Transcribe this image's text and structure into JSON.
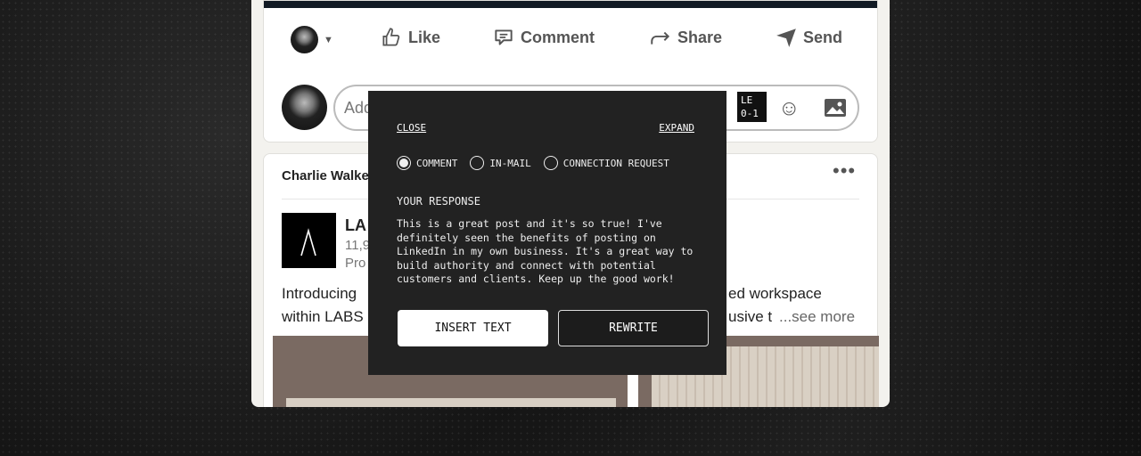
{
  "post_actions": {
    "like": "Like",
    "comment": "Comment",
    "share": "Share",
    "send": "Send"
  },
  "comment_input": {
    "placeholder_visible": "Add"
  },
  "extension_badge": {
    "line1": "LE",
    "line2": "0-1"
  },
  "feed_post": {
    "author_visible": "Charlie Walke",
    "company_visible": "LA",
    "followers_visible": "11,9",
    "promoted_visible": "Pro",
    "text_left_1": "Introducing",
    "text_left_2": "within LABS",
    "text_right_1": "ed workspace",
    "text_right_2": "usive t",
    "see_more": "...see more"
  },
  "popup": {
    "close": "CLOSE",
    "expand": "EXPAND",
    "options": [
      {
        "label": "COMMENT",
        "selected": true
      },
      {
        "label": "IN-MAIL",
        "selected": false
      },
      {
        "label": "CONNECTION REQUEST",
        "selected": false
      }
    ],
    "response_label": "YOUR RESPONSE",
    "response_text": "This is a great post and it's so true! I've definitely seen the benefits of posting on LinkedIn in my own business. It's a great way to build authority and connect with potential customers and clients. Keep up the good work!",
    "insert_button": "INSERT TEXT",
    "rewrite_button": "REWRITE"
  }
}
